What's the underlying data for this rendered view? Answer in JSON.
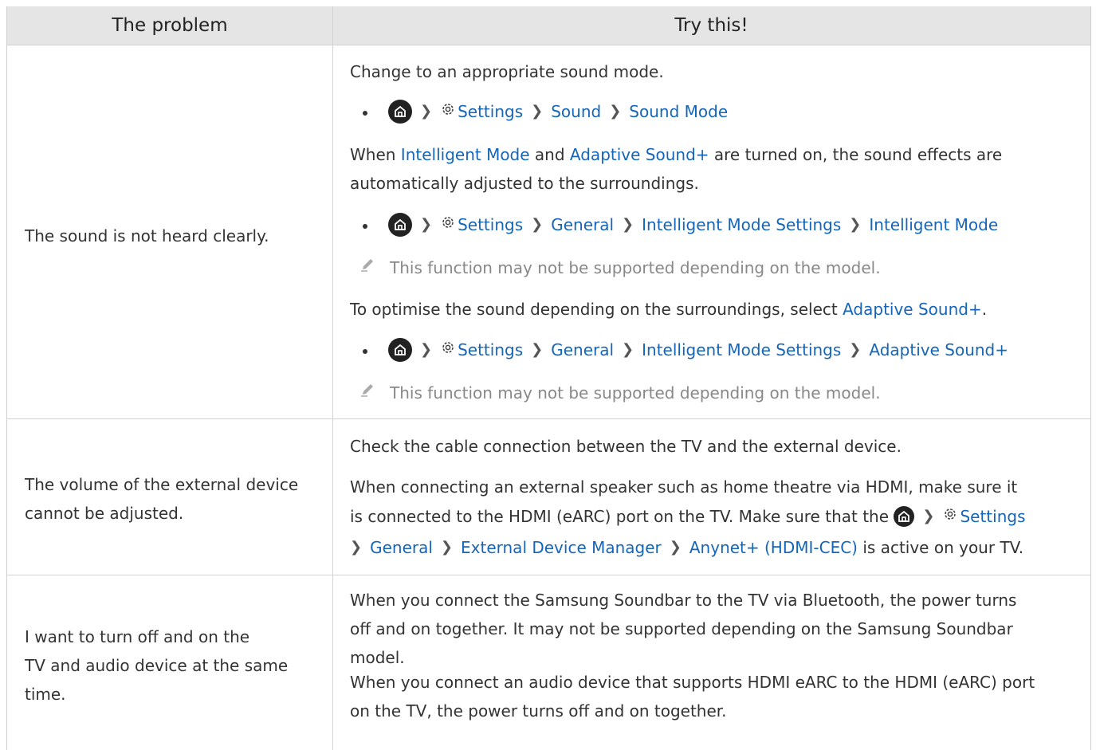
{
  "header": {
    "col1": "The problem",
    "col2": "Try this!"
  },
  "rows": [
    {
      "problem": "The sound is not heard clearly.",
      "p1": "Change to an appropriate sound mode.",
      "nav1": [
        "Settings",
        "Sound",
        "Sound Mode"
      ],
      "p2_a": "When ",
      "p2_link1": "Intelligent Mode",
      "p2_b": " and ",
      "p2_link2": "Adaptive Sound+",
      "p2_c": " are turned on, the sound effects are automatically adjusted to the surroundings.",
      "nav2": [
        "Settings",
        "General",
        "Intelligent Mode Settings",
        "Intelligent Mode"
      ],
      "note1": "This function may not be supported depending on the model.",
      "p3_a": "To optimise the sound depending on the surroundings, select ",
      "p3_link": "Adaptive Sound+",
      "p3_b": ".",
      "nav3": [
        "Settings",
        "General",
        "Intelligent Mode Settings",
        "Adaptive Sound+"
      ],
      "note2": "This function may not be supported depending on the model."
    },
    {
      "problem_l1": "The volume of the external device",
      "problem_l2": "cannot be adjusted.",
      "p1": "Check the cable connection between the TV and the external device.",
      "p2_l1": "When connecting an external speaker such as home theatre via HDMI, make sure it",
      "p2_l2": "is connected to the HDMI (eARC) port on the TV. Make sure that the ",
      "p2_settings": "Settings",
      "p2_nav": [
        "General",
        "External Device Manager",
        "Anynet+ (HDMI-CEC)"
      ],
      "p2_end": " is active on your TV."
    },
    {
      "problem_l1": "I want to turn off and on the",
      "problem_l2": "TV and audio device at the same",
      "problem_l3": "time.",
      "p1_l1": "When you connect the Samsung Soundbar to the TV via Bluetooth, the power turns",
      "p1_l2": "off and on together. It may not be supported depending on the Samsung Soundbar",
      "p1_l3": "model.",
      "p2_l1": "When you connect an audio device that supports HDMI eARC to the HDMI (eARC) port",
      "p2_l2": "on the TV, the power turns off and on together."
    }
  ],
  "colors": {
    "link": "#1565b8",
    "header_bg": "#e5e5e5",
    "note": "#888888"
  }
}
